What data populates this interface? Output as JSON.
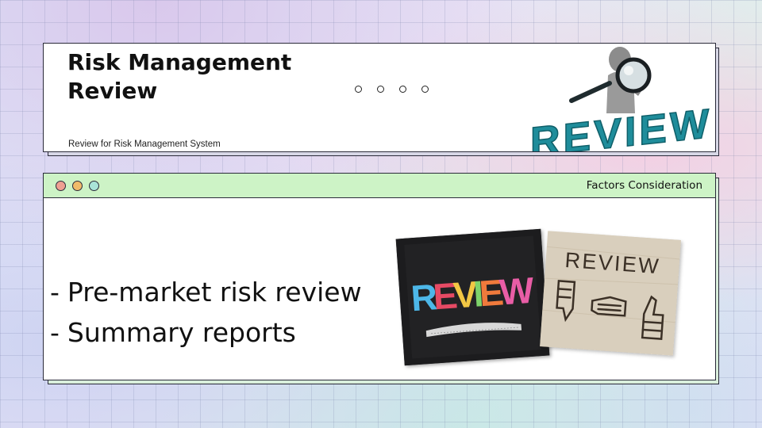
{
  "header": {
    "title": "Risk Management Review",
    "subtitle": "Review for Risk Management System",
    "hero_icon": "magnifier-review-icon",
    "hero_word": "REVIEW"
  },
  "panel": {
    "title": "Factors Consideration",
    "bullets": [
      "Pre-market risk review",
      "Summary reports"
    ],
    "photo_chalk_word": "REVIEW",
    "photo_wood_word": "REVIEW"
  },
  "colors": {
    "titlebar": "#cdf3c6",
    "dot_red": "#ef9f92",
    "dot_yellow": "#f1bb6a",
    "dot_green": "#a9e4d8",
    "review_teal": "#1f8d9b"
  }
}
